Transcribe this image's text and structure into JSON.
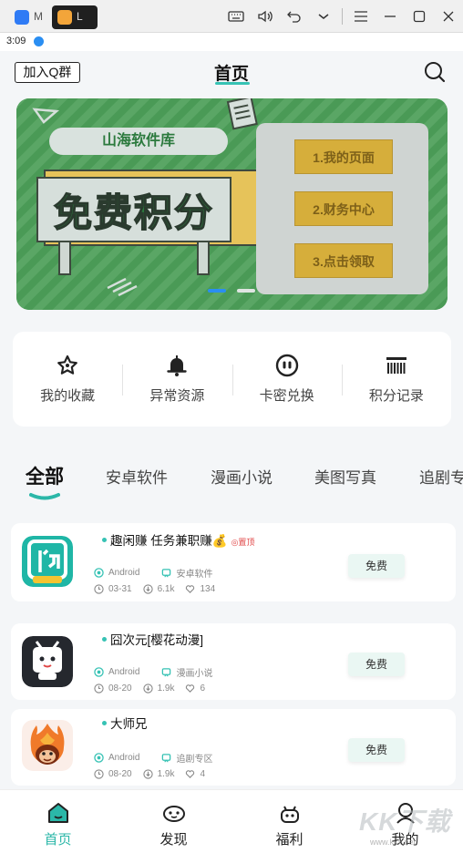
{
  "emulator": {
    "tabs": [
      {
        "label": "M"
      },
      {
        "label": "L"
      }
    ]
  },
  "status": {
    "time": "3:09"
  },
  "header": {
    "join_label": "加入Q群",
    "title": "首页"
  },
  "banner": {
    "pill": "山海软件库",
    "board": "免费积分",
    "buttons": [
      "1.我的页面",
      "2.财务中心",
      "3.点击领取"
    ]
  },
  "shortcuts": [
    {
      "label": "我的收藏",
      "icon": "star-icon"
    },
    {
      "label": "异常资源",
      "icon": "bell-icon"
    },
    {
      "label": "卡密兑换",
      "icon": "face-icon"
    },
    {
      "label": "积分记录",
      "icon": "barcode-icon"
    }
  ],
  "tabs": [
    "全部",
    "安卓软件",
    "漫画小说",
    "美图写真",
    "追剧专区"
  ],
  "apps": [
    {
      "name": "趣闲赚 任务兼职赚💰",
      "pin": "◎置顶",
      "platform": "Android",
      "category": "安卓软件",
      "date": "03-31",
      "downloads": "6.1k",
      "likes": "134",
      "button": "免费"
    },
    {
      "name": "囧次元[樱花动漫]",
      "pin": "",
      "platform": "Android",
      "category": "漫画小说",
      "date": "08-20",
      "downloads": "1.9k",
      "likes": "6",
      "button": "免费"
    },
    {
      "name": "大师兄",
      "pin": "",
      "platform": "Android",
      "category": "追剧专区",
      "date": "08-20",
      "downloads": "1.9k",
      "likes": "4",
      "button": "免费"
    }
  ],
  "nav": [
    {
      "label": "首页",
      "icon": "home-icon"
    },
    {
      "label": "发现",
      "icon": "discover-icon"
    },
    {
      "label": "福利",
      "icon": "gift-icon"
    },
    {
      "label": "我的",
      "icon": "profile-icon"
    }
  ],
  "watermark": {
    "main": "KK下载",
    "sub": "www.kkx.net"
  },
  "colors": {
    "accent": "#36c2b4",
    "banner_green": "#4a9a56",
    "banner_gold": "#d6ae3b"
  }
}
